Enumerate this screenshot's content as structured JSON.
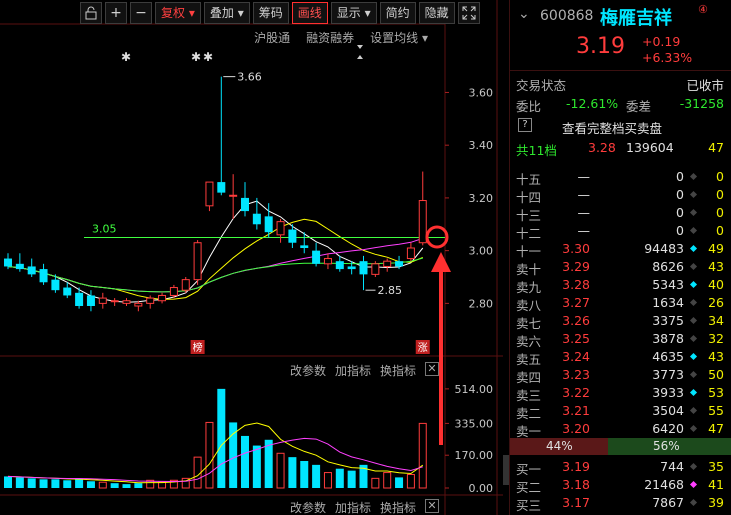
{
  "toolbar": {
    "lock_icon": "lock-icon",
    "plus": "+",
    "minus": "−",
    "fuquan": "复权",
    "diejia": "叠加",
    "chouma": "筹码",
    "huaxian": "画线",
    "xianshi": "显示",
    "jianyue": "简约",
    "yincang": "隐藏",
    "expand_icon": "expand-icon"
  },
  "subbar": {
    "hugutong": "沪股通",
    "rongzi": "融资融券",
    "shezhi": "设置均线"
  },
  "chart_labels": {
    "high_label": "3.66",
    "low_label": "2.85",
    "ref_line_label": "3.05",
    "bang": "榜",
    "zhang": "涨",
    "star": "✱"
  },
  "indicator_bar": {
    "gaicanshu": "改参数",
    "jiazhibiao": "加指标",
    "huanzhibiao": "换指标",
    "close": "✕"
  },
  "bottom_bar": {
    "gaicanshu": "改参数",
    "jiazhibiao": "加指标",
    "huanzhibiao": "换指标",
    "close": "✕"
  },
  "colors": {
    "up": "#ff3c3c",
    "down": "#00e5ff",
    "ma5": "#ffffff",
    "ma10": "#ffff00",
    "ma20": "#ff40ff",
    "ma60": "#40ff40"
  },
  "chart_data": {
    "type": "candlestick",
    "price_axis": {
      "ticks": [
        "3.60",
        "3.40",
        "3.20",
        "3.00",
        "2.80"
      ],
      "ylim": [
        2.68,
        3.78
      ]
    },
    "volume_axis": {
      "ticks": [
        "514.00",
        "335.00",
        "170.00",
        "0.00"
      ],
      "ylim": [
        0,
        560
      ]
    },
    "reference_price": 3.05,
    "candles": [
      {
        "o": 2.97,
        "h": 2.99,
        "l": 2.93,
        "c": 2.94
      },
      {
        "o": 2.95,
        "h": 2.99,
        "l": 2.92,
        "c": 2.93
      },
      {
        "o": 2.94,
        "h": 2.97,
        "l": 2.9,
        "c": 2.91
      },
      {
        "o": 2.93,
        "h": 2.95,
        "l": 2.87,
        "c": 2.88
      },
      {
        "o": 2.89,
        "h": 2.91,
        "l": 2.84,
        "c": 2.85
      },
      {
        "o": 2.86,
        "h": 2.88,
        "l": 2.82,
        "c": 2.83
      },
      {
        "o": 2.84,
        "h": 2.86,
        "l": 2.78,
        "c": 2.79
      },
      {
        "o": 2.83,
        "h": 2.85,
        "l": 2.77,
        "c": 2.79
      },
      {
        "o": 2.8,
        "h": 2.84,
        "l": 2.78,
        "c": 2.82
      },
      {
        "o": 2.81,
        "h": 2.82,
        "l": 2.79,
        "c": 2.81
      },
      {
        "o": 2.8,
        "h": 2.82,
        "l": 2.79,
        "c": 2.81
      },
      {
        "o": 2.79,
        "h": 2.81,
        "l": 2.77,
        "c": 2.8
      },
      {
        "o": 2.8,
        "h": 2.83,
        "l": 2.78,
        "c": 2.82
      },
      {
        "o": 2.81,
        "h": 2.84,
        "l": 2.8,
        "c": 2.83
      },
      {
        "o": 2.83,
        "h": 2.87,
        "l": 2.82,
        "c": 2.86
      },
      {
        "o": 2.85,
        "h": 2.9,
        "l": 2.84,
        "c": 2.89
      },
      {
        "o": 2.89,
        "h": 3.04,
        "l": 2.87,
        "c": 3.03
      },
      {
        "o": 3.17,
        "h": 3.26,
        "l": 3.15,
        "c": 3.26
      },
      {
        "o": 3.26,
        "h": 3.66,
        "l": 3.21,
        "c": 3.22
      },
      {
        "o": 3.21,
        "h": 3.29,
        "l": 3.12,
        "c": 3.21
      },
      {
        "o": 3.2,
        "h": 3.26,
        "l": 3.13,
        "c": 3.15
      },
      {
        "o": 3.14,
        "h": 3.2,
        "l": 3.08,
        "c": 3.1
      },
      {
        "o": 3.13,
        "h": 3.18,
        "l": 3.05,
        "c": 3.07
      },
      {
        "o": 3.06,
        "h": 3.12,
        "l": 3.03,
        "c": 3.11
      },
      {
        "o": 3.08,
        "h": 3.1,
        "l": 3.01,
        "c": 3.03
      },
      {
        "o": 3.02,
        "h": 3.07,
        "l": 2.99,
        "c": 3.01
      },
      {
        "o": 3.0,
        "h": 3.03,
        "l": 2.94,
        "c": 2.95
      },
      {
        "o": 2.95,
        "h": 2.99,
        "l": 2.93,
        "c": 2.97
      },
      {
        "o": 2.96,
        "h": 2.98,
        "l": 2.92,
        "c": 2.93
      },
      {
        "o": 2.94,
        "h": 2.96,
        "l": 2.91,
        "c": 2.93
      },
      {
        "o": 2.96,
        "h": 2.98,
        "l": 2.85,
        "c": 2.91
      },
      {
        "o": 2.91,
        "h": 2.96,
        "l": 2.9,
        "c": 2.95
      },
      {
        "o": 2.94,
        "h": 2.97,
        "l": 2.92,
        "c": 2.96
      },
      {
        "o": 2.96,
        "h": 2.98,
        "l": 2.93,
        "c": 2.94
      },
      {
        "o": 2.97,
        "h": 3.03,
        "l": 2.96,
        "c": 3.01
      },
      {
        "o": 3.03,
        "h": 3.3,
        "l": 3.02,
        "c": 3.19
      }
    ],
    "volumes": [
      {
        "v": 60,
        "up": false
      },
      {
        "v": 55,
        "up": false
      },
      {
        "v": 50,
        "up": false
      },
      {
        "v": 45,
        "up": false
      },
      {
        "v": 45,
        "up": false
      },
      {
        "v": 40,
        "up": false
      },
      {
        "v": 50,
        "up": false
      },
      {
        "v": 35,
        "up": false
      },
      {
        "v": 30,
        "up": true
      },
      {
        "v": 25,
        "up": false
      },
      {
        "v": 20,
        "up": false
      },
      {
        "v": 25,
        "up": false
      },
      {
        "v": 40,
        "up": true
      },
      {
        "v": 30,
        "up": true
      },
      {
        "v": 40,
        "up": true
      },
      {
        "v": 50,
        "up": true
      },
      {
        "v": 160,
        "up": true
      },
      {
        "v": 340,
        "up": true
      },
      {
        "v": 514,
        "up": false
      },
      {
        "v": 340,
        "up": false
      },
      {
        "v": 270,
        "up": false
      },
      {
        "v": 220,
        "up": false
      },
      {
        "v": 250,
        "up": false
      },
      {
        "v": 180,
        "up": true
      },
      {
        "v": 160,
        "up": false
      },
      {
        "v": 140,
        "up": false
      },
      {
        "v": 120,
        "up": false
      },
      {
        "v": 80,
        "up": true
      },
      {
        "v": 100,
        "up": false
      },
      {
        "v": 90,
        "up": false
      },
      {
        "v": 120,
        "up": false
      },
      {
        "v": 50,
        "up": true
      },
      {
        "v": 80,
        "up": true
      },
      {
        "v": 55,
        "up": false
      },
      {
        "v": 70,
        "up": true
      },
      {
        "v": 335,
        "up": true
      }
    ]
  },
  "quote": {
    "code": "600868",
    "name": "梅雁吉祥",
    "badge": "④",
    "price": "3.19",
    "change": "+0.19",
    "pct": "+6.33%",
    "status_label": "交易状态",
    "status_value": "已收市",
    "weibi_label": "委比",
    "weibi_value": "-12.61%",
    "weicha_label": "委差",
    "weicha_value": "-31258",
    "help": "?",
    "full_depth": "查看完整档买卖盘",
    "total_label": "共11档",
    "total_price": "3.28",
    "total_vol": "139604",
    "total_cnt": "47",
    "sell_rows": [
      {
        "label": "十五",
        "price": "—",
        "vol": "0",
        "cnt": "0"
      },
      {
        "label": "十四",
        "price": "—",
        "vol": "0",
        "cnt": "0"
      },
      {
        "label": "十三",
        "price": "—",
        "vol": "0",
        "cnt": "0"
      },
      {
        "label": "十二",
        "price": "—",
        "vol": "0",
        "cnt": "0"
      },
      {
        "label": "十一",
        "price": "3.30",
        "vol": "94483",
        "cnt": "49"
      },
      {
        "label": "卖十",
        "price": "3.29",
        "vol": "8626",
        "cnt": "43"
      },
      {
        "label": "卖九",
        "price": "3.28",
        "vol": "5343",
        "cnt": "40"
      },
      {
        "label": "卖八",
        "price": "3.27",
        "vol": "1634",
        "cnt": "26"
      },
      {
        "label": "卖七",
        "price": "3.26",
        "vol": "3375",
        "cnt": "34"
      },
      {
        "label": "卖六",
        "price": "3.25",
        "vol": "3878",
        "cnt": "32"
      },
      {
        "label": "卖五",
        "price": "3.24",
        "vol": "4635",
        "cnt": "43"
      },
      {
        "label": "卖四",
        "price": "3.23",
        "vol": "3773",
        "cnt": "50"
      },
      {
        "label": "卖三",
        "price": "3.22",
        "vol": "3933",
        "cnt": "53"
      },
      {
        "label": "卖二",
        "price": "3.21",
        "vol": "3504",
        "cnt": "55"
      },
      {
        "label": "卖一",
        "price": "3.20",
        "vol": "6420",
        "cnt": "47"
      }
    ],
    "ratio_left": "44%",
    "ratio_right": "56%",
    "buy_rows": [
      {
        "label": "买一",
        "price": "3.19",
        "vol": "744",
        "cnt": "35"
      },
      {
        "label": "买二",
        "price": "3.18",
        "vol": "21468",
        "cnt": "41"
      },
      {
        "label": "买三",
        "price": "3.17",
        "vol": "7867",
        "cnt": "39"
      }
    ]
  }
}
